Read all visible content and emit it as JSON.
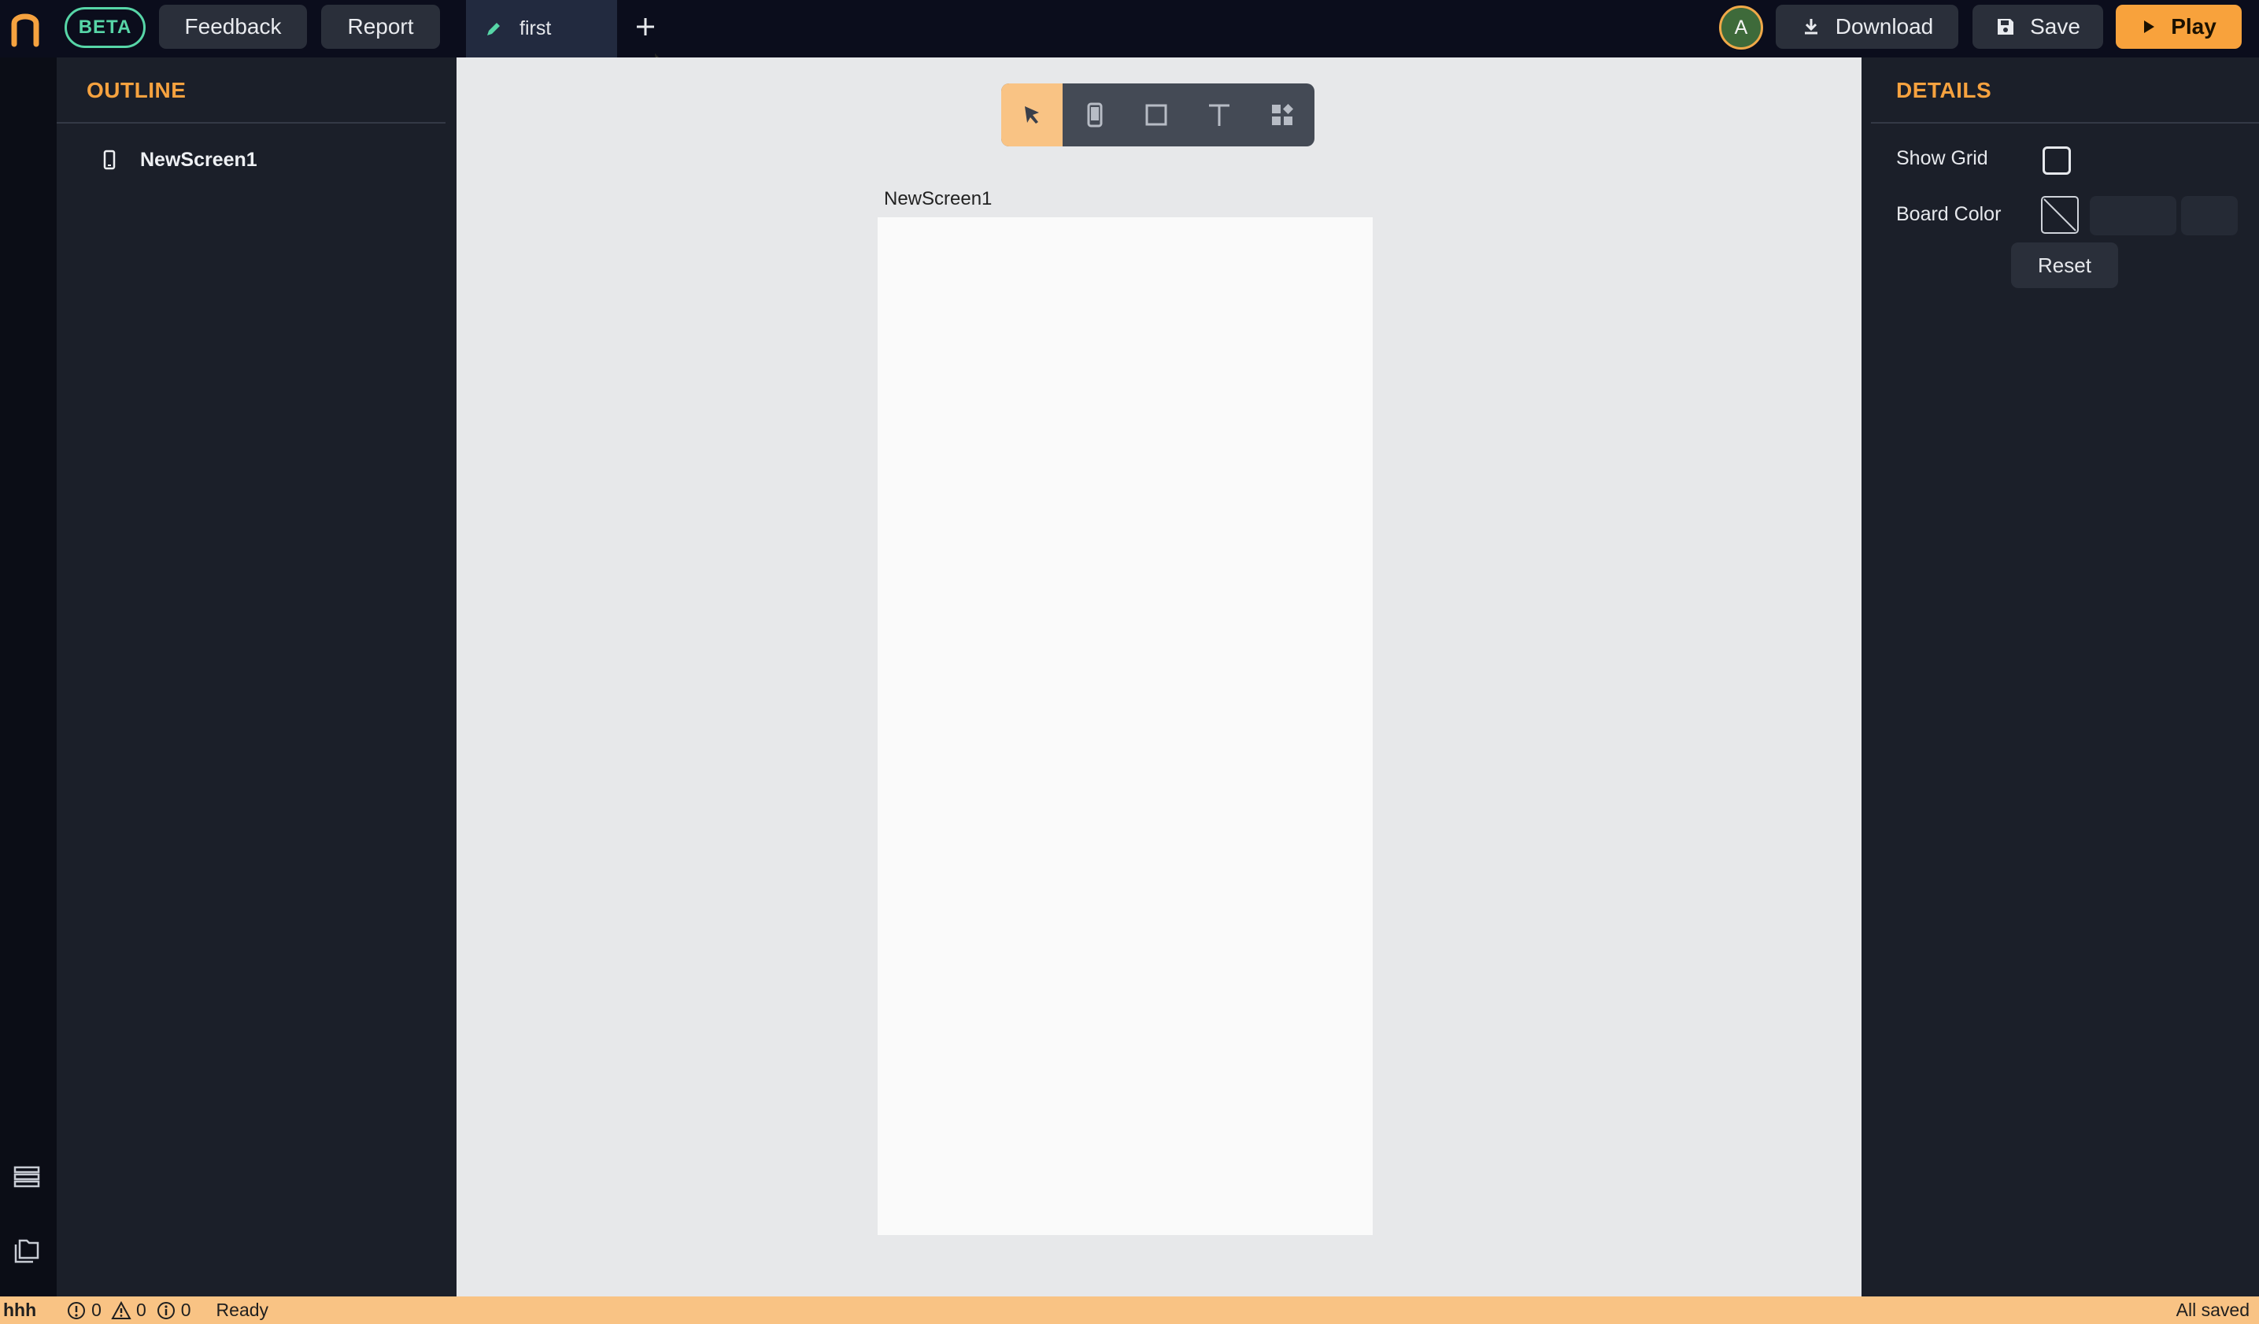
{
  "topbar": {
    "beta_label": "BETA",
    "feedback_label": "Feedback",
    "report_label": "Report",
    "tab_label": "first",
    "avatar_initial": "A",
    "download_label": "Download",
    "save_label": "Save",
    "play_label": "Play"
  },
  "outline": {
    "title": "OUTLINE",
    "items": [
      {
        "label": "NewScreen1",
        "icon": "phone-icon"
      }
    ]
  },
  "canvas": {
    "tools": [
      "select-tool",
      "screen-tool",
      "rectangle-tool",
      "text-tool",
      "components-tool"
    ],
    "active_tool": "select-tool",
    "screen_label": "NewScreen1"
  },
  "details": {
    "title": "DETAILS",
    "show_grid_label": "Show Grid",
    "show_grid_checked": false,
    "board_color_label": "Board Color",
    "reset_label": "Reset"
  },
  "status": {
    "project": "hhh",
    "errors": "0",
    "warnings": "0",
    "infos": "0",
    "state": "Ready",
    "save_state": "All saved"
  },
  "colors": {
    "accent": "#f8a23c",
    "accent_light": "#f9c384",
    "beta": "#57d5a7",
    "topbar_bg": "#0b0d1c",
    "panel_bg": "#1b1f29",
    "canvas_bg": "#e7e8ea"
  }
}
